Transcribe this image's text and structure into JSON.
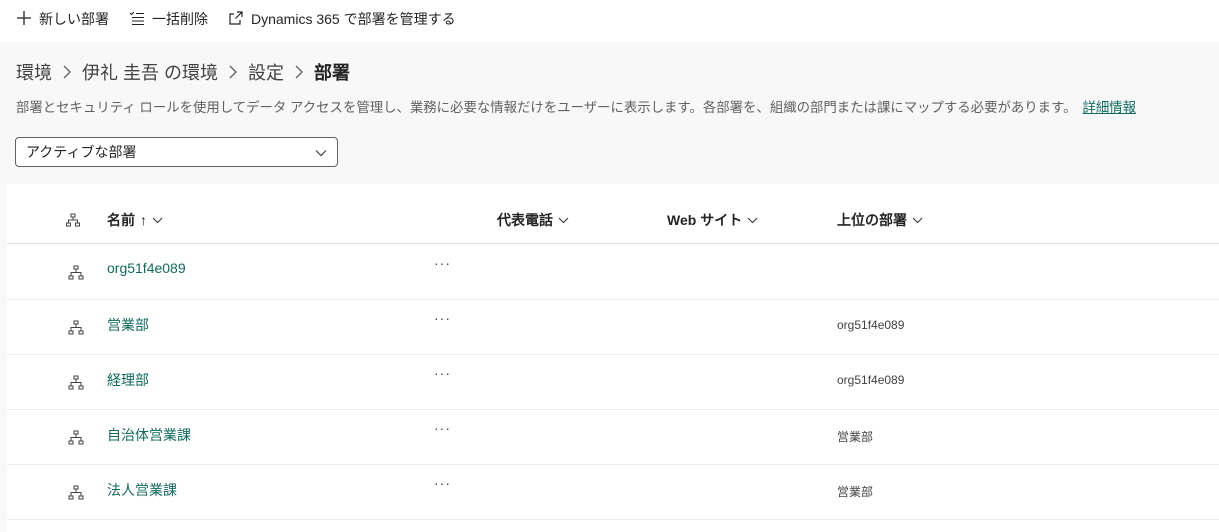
{
  "toolbar": {
    "new_label": "新しい部署",
    "bulk_delete_label": "一括削除",
    "manage_label": "Dynamics 365 で部署を管理する"
  },
  "breadcrumb": {
    "items": [
      "環境",
      "伊礼 圭吾 の環境",
      "設定",
      "部署"
    ]
  },
  "description": {
    "text": "部署とセキュリティ ロールを使用してデータ アクセスを管理し、業務に必要な情報だけをユーザーに表示します。各部署を、組織の部門または課にマップする必要があります。",
    "link": "詳細情報"
  },
  "filter": {
    "selected": "アクティブな部署"
  },
  "table": {
    "columns": {
      "name": "名前",
      "phone": "代表電話",
      "website": "Web サイト",
      "parent": "上位の部署"
    },
    "sort_indicator": "↑",
    "more_label": "···",
    "rows": [
      {
        "name": "org51f4e089",
        "phone": "",
        "website": "",
        "parent": ""
      },
      {
        "name": "営業部",
        "phone": "",
        "website": "",
        "parent": "org51f4e089"
      },
      {
        "name": "経理部",
        "phone": "",
        "website": "",
        "parent": "org51f4e089"
      },
      {
        "name": "自治体営業課",
        "phone": "",
        "website": "",
        "parent": "営業部"
      },
      {
        "name": "法人営業課",
        "phone": "",
        "website": "",
        "parent": "営業部"
      }
    ]
  },
  "colors": {
    "link": "#0f6b5f",
    "background": "#f8f8f8",
    "surface": "#ffffff"
  }
}
